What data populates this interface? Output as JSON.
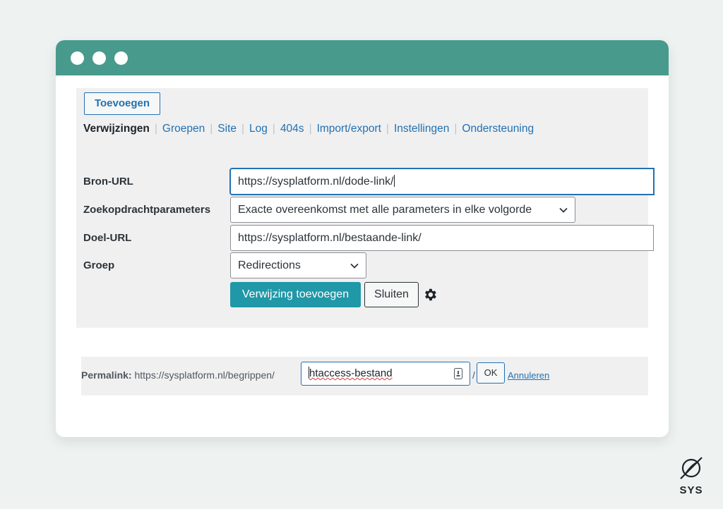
{
  "window": {
    "controls": [
      "close-dot",
      "minimize-dot",
      "maximize-dot"
    ]
  },
  "toolbar": {
    "add_button": "Toevoegen"
  },
  "nav": {
    "tabs": [
      {
        "label": "Verwijzingen",
        "current": true
      },
      {
        "label": "Groepen"
      },
      {
        "label": "Site"
      },
      {
        "label": "Log"
      },
      {
        "label": "404s"
      },
      {
        "label": "Import/export"
      },
      {
        "label": "Instellingen"
      },
      {
        "label": "Ondersteuning"
      }
    ]
  },
  "form": {
    "source_url": {
      "label": "Bron-URL",
      "value": "https://sysplatform.nl/dode-link/"
    },
    "query_params": {
      "label": "Zoekopdrachtparameters",
      "value": "Exacte overeenkomst met alle parameters in elke volgorde"
    },
    "target_url": {
      "label": "Doel-URL",
      "value": "https://sysplatform.nl/bestaande-link/"
    },
    "group": {
      "label": "Groep",
      "value": "Redirections"
    },
    "submit_label": "Verwijzing toevoegen",
    "close_label": "Sluiten"
  },
  "permalink": {
    "label": "Permalink:",
    "base_url": "https://sysplatform.nl/begrippen/",
    "slug": "htaccess-bestand",
    "trailing_slash": "/",
    "ok_label": "OK",
    "cancel_label": "Annuleren"
  },
  "logo": {
    "text": "SYS"
  },
  "colors": {
    "titlebar": "#479a8c",
    "background": "#eef3f2",
    "primary_button": "#2098a8",
    "link": "#2271b1"
  }
}
